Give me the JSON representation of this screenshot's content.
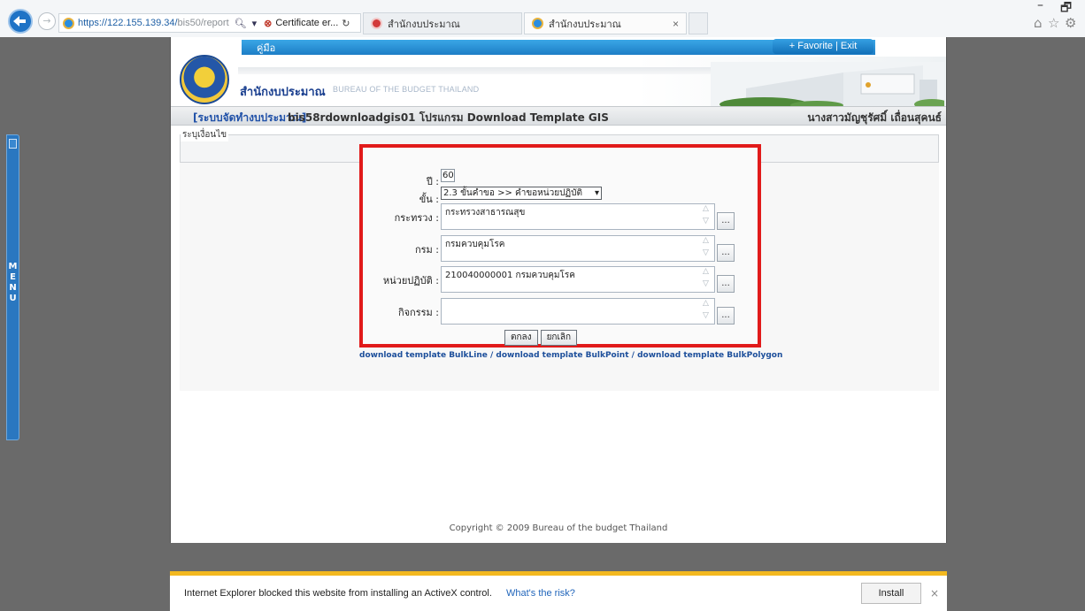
{
  "browser": {
    "url_prefix": "https://122.155.139.34/",
    "url_rest": "bis50/report",
    "search_icon": "🔍︎",
    "tools_glyph": "▾",
    "cert_label": "Certificate er...",
    "refresh_glyph": "↻",
    "tabs": [
      {
        "title": "สำนักงบประมาณ"
      },
      {
        "title": "สำนักงบประมาณ",
        "close": "×"
      }
    ],
    "minimize": "–",
    "maximize": "🗗",
    "toolbar_icons": [
      "home-icon",
      "star-icon",
      "gear-icon"
    ]
  },
  "side_menu": {
    "letters": [
      "M",
      "E",
      "N",
      "U"
    ]
  },
  "header": {
    "manual_link": "คู่มือ",
    "favorite_exit": "+ Favorite | Exit",
    "org_name_th": "สำนักงบประมาณ",
    "org_name_en": "BUREAU OF THE BUDGET THAILAND",
    "system_tag": "[ระบบจัดทำงบประมาณ]",
    "program_title": "bis58rdownloadgis01 โปรแกรม Download Template GIS",
    "user_name": "นางสาวมัญชุรัศมิ์ เถื่อนสุคนธ์"
  },
  "criteria": {
    "legend": "ระบุเงื่อนไข"
  },
  "form": {
    "year_label": "ปี :",
    "year_value": "60",
    "stage_label": "ขั้น :",
    "stage_value": "2.3 ขั้นคำขอ >> คำขอหน่วยปฏิบัติ",
    "ministry_label": "กระทรวง :",
    "ministry_value": "กระทรวงสาธารณสุข",
    "department_label": "กรม :",
    "department_value": "กรมควบคุมโรค",
    "unit_label": "หน่วยปฏิบัติ :",
    "unit_value": "210040000001 กรมควบคุมโรค",
    "activity_label": "กิจกรรม :",
    "activity_value": "",
    "picker_label": "...",
    "ok_button": "ตกลง",
    "cancel_button": "ยกเลิก"
  },
  "download_links": {
    "bulkline": "download template BulkLine",
    "sep": " / ",
    "bulkpoint": "download template BulkPoint",
    "bulkpolygon": "download template BulkPolygon"
  },
  "footer": {
    "copyright": "Copyright © 2009 Bureau of the budget Thailand"
  },
  "notification": {
    "message": "Internet Explorer blocked this website from installing an ActiveX control.",
    "risk_link": "What's the risk?",
    "install_button": "Install",
    "close": "×"
  }
}
